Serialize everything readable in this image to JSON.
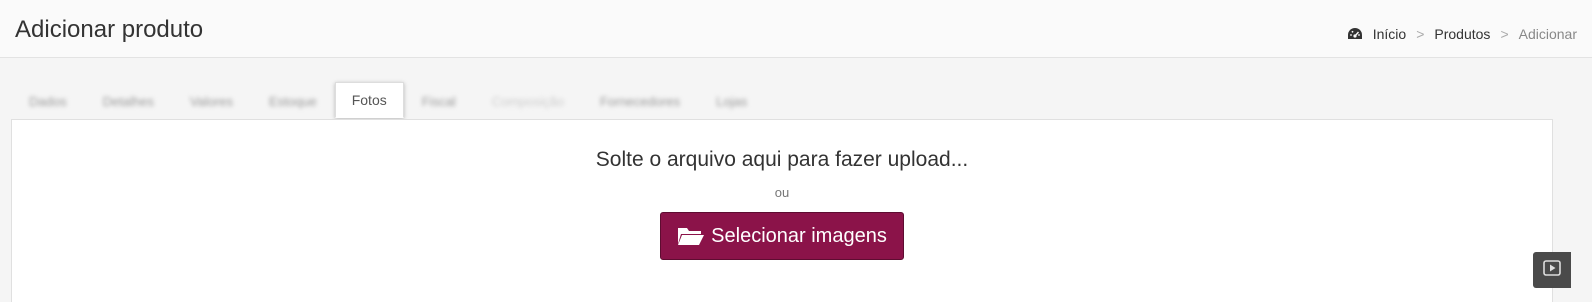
{
  "header": {
    "title": "Adicionar produto",
    "breadcrumb": [
      {
        "label": "Início",
        "icon": "dashboard-icon"
      },
      {
        "label": "Produtos"
      },
      {
        "label": "Adicionar",
        "active": true
      }
    ],
    "separator": ">"
  },
  "tabs": [
    {
      "label": "Dados"
    },
    {
      "label": "Detalhes"
    },
    {
      "label": "Valores"
    },
    {
      "label": "Estoque"
    },
    {
      "label": "Fotos",
      "active": true
    },
    {
      "label": "Fiscal"
    },
    {
      "label": "Composição",
      "disabled": true
    },
    {
      "label": "Fornecedores"
    },
    {
      "label": "Lojas"
    }
  ],
  "upload": {
    "drop_text": "Solte o arquivo aqui para fazer upload...",
    "or_text": "ou",
    "button_label": "Selecionar imagens",
    "button_icon": "folder-open-icon"
  },
  "float_button_icon": "play-icon",
  "colors": {
    "accent": "#8b1349",
    "header_bg": "#fafafa",
    "page_bg": "#f5f5f5"
  }
}
